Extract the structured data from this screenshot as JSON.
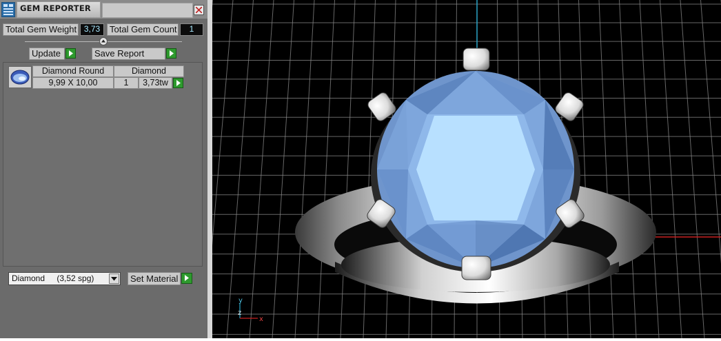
{
  "panel": {
    "title": "GEM REPORTER",
    "total_weight_label": "Total Gem Weight",
    "total_weight_value": "3,73",
    "total_count_label": "Total Gem Count",
    "total_count_value": "1",
    "update_label": "Update",
    "save_report_label": "Save Report"
  },
  "gem_list": [
    {
      "name": "Diamond Round",
      "material": "Diamond",
      "size": "9,99 X 10,00",
      "count": "1",
      "weight": "3,73tw"
    }
  ],
  "material": {
    "selected_name": "Diamond",
    "selected_sg": "(3,52 spg)",
    "set_material_label": "Set Material"
  },
  "axis": {
    "y_label": "y",
    "z_label": "z",
    "x_label": "x"
  },
  "colors": {
    "gem": "#7ea6dc",
    "grid": "#8a8a8a",
    "accent_green": "#2e9a2e",
    "value_text": "#a8e8ff"
  }
}
